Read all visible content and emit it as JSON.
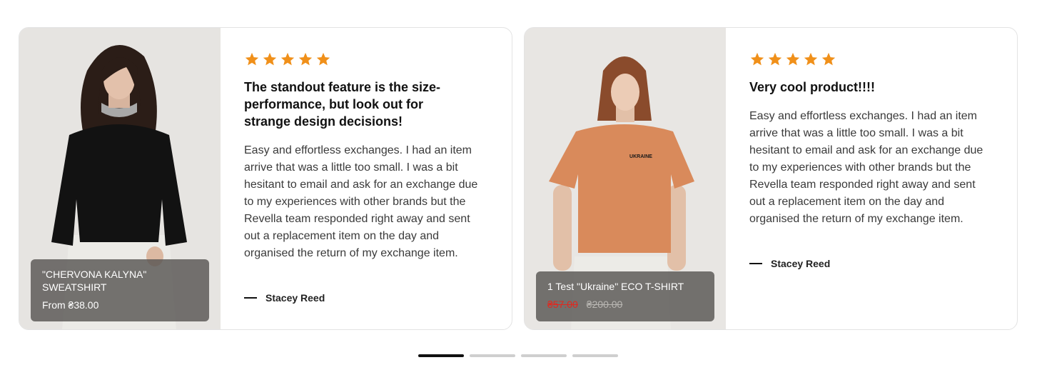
{
  "reviews": [
    {
      "rating": 5,
      "title": "The standout feature is the size-performance, but look out for strange design decisions!",
      "body": "Easy and effortless exchanges. I had an item arrive that was a little too small. I was a bit hesitant to email and ask for an exchange due to my experiences with other brands but the Revella team responded right away and sent out a replacement item on the day and organised the return of my exchange item.",
      "author": "Stacey Reed",
      "product": {
        "name": "\"CHERVONA KALYNA\" SWEATSHIRT",
        "price": "From ₴38.00",
        "image": "woman-in-black-sweatshirt"
      }
    },
    {
      "rating": 5,
      "title": "Very cool product!!!!",
      "body": "Easy and effortless exchanges. I had an item arrive that was a little too small. I was a bit hesitant to email and ask for an exchange due to my experiences with other brands but the Revella team responded right away and sent out a replacement item on the day and organised the return of my exchange item.",
      "author": "Stacey Reed",
      "product": {
        "name": "1 Test \"Ukraine\" ECO T-SHIRT",
        "sale_price": "₴57.00",
        "old_price": "₴200.00",
        "shirt_print": "UKRAINE",
        "image": "woman-in-orange-tshirt"
      }
    }
  ],
  "pagination": {
    "count": 4,
    "active": 0
  },
  "colors": {
    "star": "#f0901a",
    "sale": "#e0281f",
    "overlay": "#585653",
    "active_dot": "#111111",
    "inactive_dot": "#cfcfcf"
  }
}
